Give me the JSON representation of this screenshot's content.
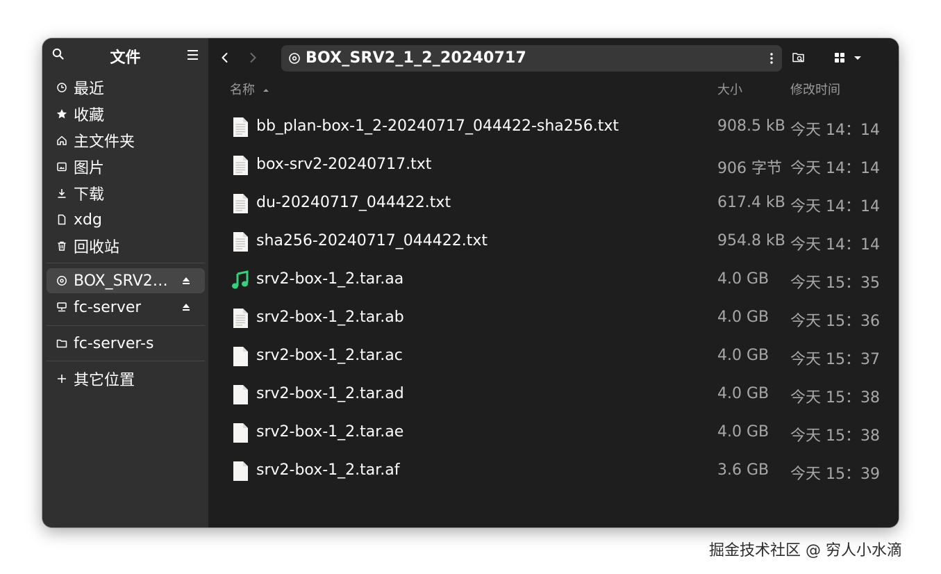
{
  "sidebar": {
    "title": "文件",
    "places": [
      {
        "label": "最近",
        "icon": "clock-icon"
      },
      {
        "label": "收藏",
        "icon": "star-icon"
      },
      {
        "label": "主文件夹",
        "icon": "home-icon"
      },
      {
        "label": "图片",
        "icon": "image-icon"
      },
      {
        "label": "下载",
        "icon": "download-icon"
      },
      {
        "label": "xdg",
        "icon": "document-icon"
      },
      {
        "label": "回收站",
        "icon": "trash-icon"
      }
    ],
    "devices": [
      {
        "label": "BOX_SRV2_1_2_20240717",
        "icon": "disc-icon",
        "active": true
      },
      {
        "label": "fc-server",
        "icon": "network-icon",
        "active": false
      }
    ],
    "bookmarks": [
      {
        "label": "fc-server-s",
        "icon": "folder-icon"
      }
    ],
    "other_locations": "其它位置"
  },
  "toolbar": {
    "path": "BOX_SRV2_1_2_20240717"
  },
  "columns": {
    "name": "名称",
    "size": "大小",
    "modified": "修改时间"
  },
  "files": [
    {
      "name": "bb_plan-box-1_2-20240717_044422-sha256.txt",
      "size": "908.5 kB",
      "modified": "今天 14：14",
      "type": "text"
    },
    {
      "name": "box-srv2-20240717.txt",
      "size": "906 字节",
      "modified": "今天 14：14",
      "type": "text"
    },
    {
      "name": "du-20240717_044422.txt",
      "size": "617.4 kB",
      "modified": "今天 14：14",
      "type": "text"
    },
    {
      "name": "sha256-20240717_044422.txt",
      "size": "954.8 kB",
      "modified": "今天 14：14",
      "type": "text"
    },
    {
      "name": "srv2-box-1_2.tar.aa",
      "size": "4.0 GB",
      "modified": "今天 15：35",
      "type": "audio"
    },
    {
      "name": "srv2-box-1_2.tar.ab",
      "size": "4.0 GB",
      "modified": "今天 15：36",
      "type": "text"
    },
    {
      "name": "srv2-box-1_2.tar.ac",
      "size": "4.0 GB",
      "modified": "今天 15：37",
      "type": "blank"
    },
    {
      "name": "srv2-box-1_2.tar.ad",
      "size": "4.0 GB",
      "modified": "今天 15：38",
      "type": "blank"
    },
    {
      "name": "srv2-box-1_2.tar.ae",
      "size": "4.0 GB",
      "modified": "今天 15：38",
      "type": "blank"
    },
    {
      "name": "srv2-box-1_2.tar.af",
      "size": "3.6 GB",
      "modified": "今天 15：39",
      "type": "blank"
    }
  ],
  "watermark": "掘金技术社区 @ 穷人小水滴",
  "colors": {
    "sidebar_bg": "#303030",
    "main_bg": "#1e1e1e",
    "accent_audio": "#33d17a"
  }
}
